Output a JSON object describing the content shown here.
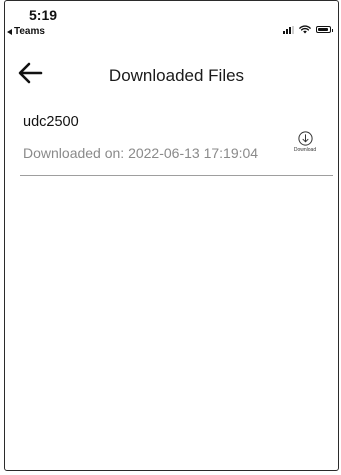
{
  "status_bar": {
    "time": "5:19",
    "back_app": "Teams"
  },
  "header": {
    "title": "Downloaded Files",
    "back_icon": "arrow-left-icon"
  },
  "files": [
    {
      "name": "udc2500",
      "downloaded_on": "Downloaded on: 2022-06-13 17:19:04",
      "action_label": "Download",
      "action_icon": "download-circle-icon"
    }
  ],
  "colors": {
    "text_primary": "#1a1a1a",
    "text_secondary": "#8a8a8a",
    "divider": "#9e9e9e"
  }
}
